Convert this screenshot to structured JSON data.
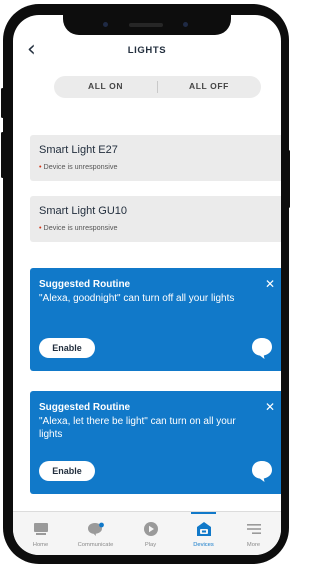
{
  "header": {
    "title": "LIGHTS",
    "back_icon": "back-arrow-icon"
  },
  "toggle": {
    "all_on": "ALL ON",
    "all_off": "ALL OFF"
  },
  "devices": [
    {
      "name": "Smart Light E27",
      "status": "Device is unresponsive"
    },
    {
      "name": "Smart Light GU10",
      "status": "Device is unresponsive"
    }
  ],
  "routines": [
    {
      "title": "Suggested Routine",
      "text": "\"Alexa, goodnight\" can turn off all your lights",
      "enable_label": "Enable"
    },
    {
      "title": "Suggested Routine",
      "text": "\"Alexa, let there be light\" can turn on all your lights",
      "enable_label": "Enable"
    }
  ],
  "nav": [
    {
      "label": "Home",
      "icon": "home-icon"
    },
    {
      "label": "Communicate",
      "icon": "chat-icon"
    },
    {
      "label": "Play",
      "icon": "play-icon"
    },
    {
      "label": "Devices",
      "icon": "devices-icon"
    },
    {
      "label": "More",
      "icon": "menu-icon"
    }
  ],
  "colors": {
    "accent": "#1179c9",
    "status_dot": "#d13212",
    "card_bg": "#ebebeb",
    "text_dark": "#232f3e"
  }
}
